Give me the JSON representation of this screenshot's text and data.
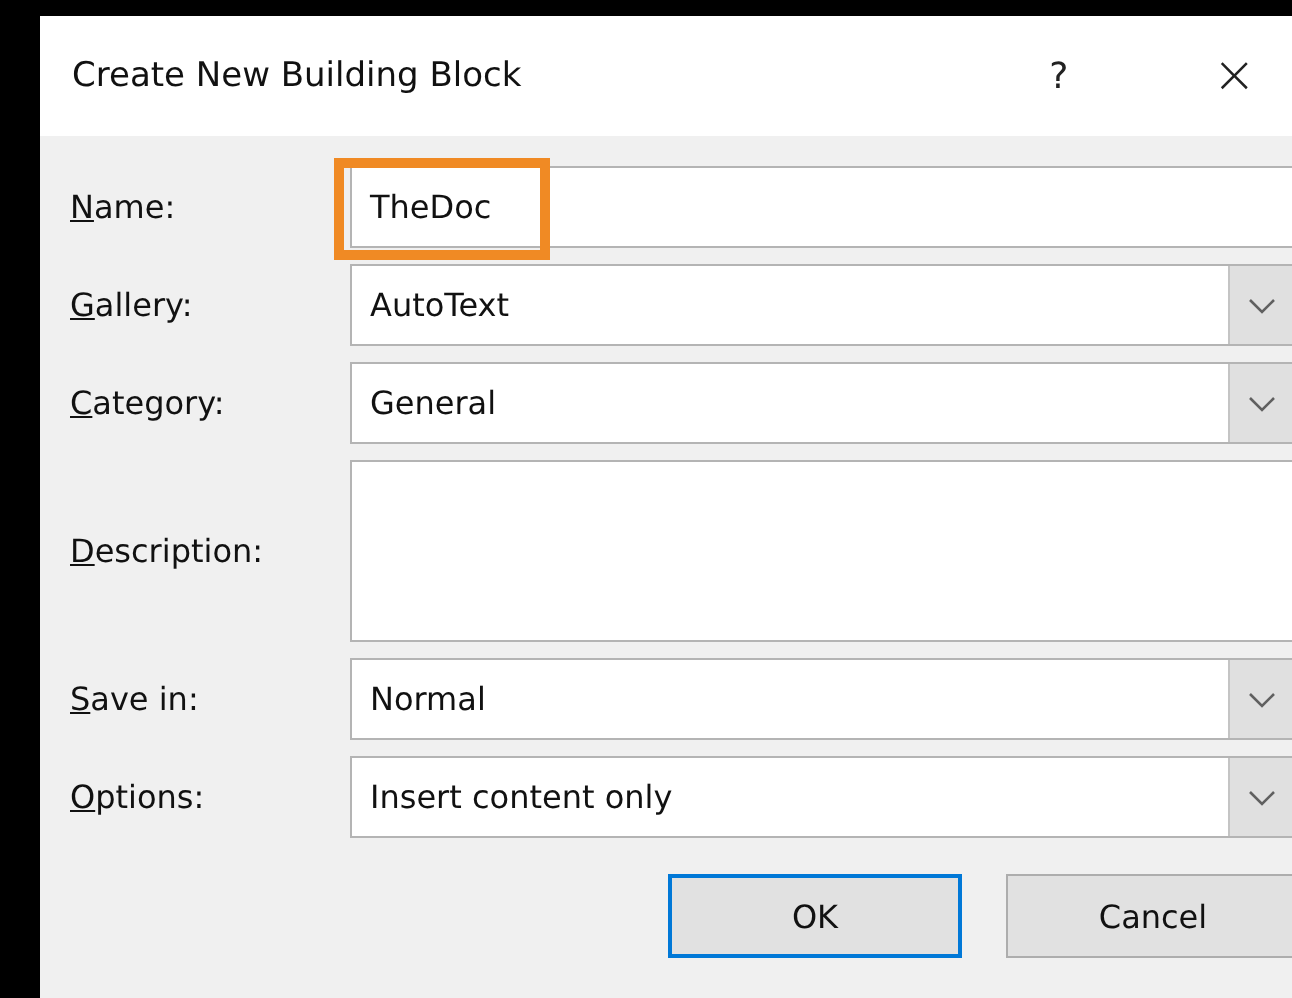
{
  "window": {
    "title": "Create New Building Block",
    "help": "?",
    "close": "×"
  },
  "fields": [
    {
      "kind": "text",
      "label_key": "N",
      "label_rest": "ame:",
      "value": "TheDoc",
      "highlighted": true
    },
    {
      "kind": "combo",
      "label_key": "G",
      "label_rest": "allery:",
      "value": "AutoText"
    },
    {
      "kind": "combo",
      "label_key": "C",
      "label_rest": "ategory:",
      "value": "General"
    },
    {
      "kind": "textarea",
      "label_key": "D",
      "label_rest": "escription:"
    },
    {
      "kind": "combo",
      "label_key": "S",
      "label_rest": "ave in:",
      "value": "Normal"
    },
    {
      "kind": "combo",
      "label_key": "O",
      "label_rest": "ptions:",
      "value": "Insert content only"
    }
  ],
  "buttons": [
    {
      "label": "OK",
      "default": true
    },
    {
      "label": "Cancel",
      "default": false
    }
  ]
}
